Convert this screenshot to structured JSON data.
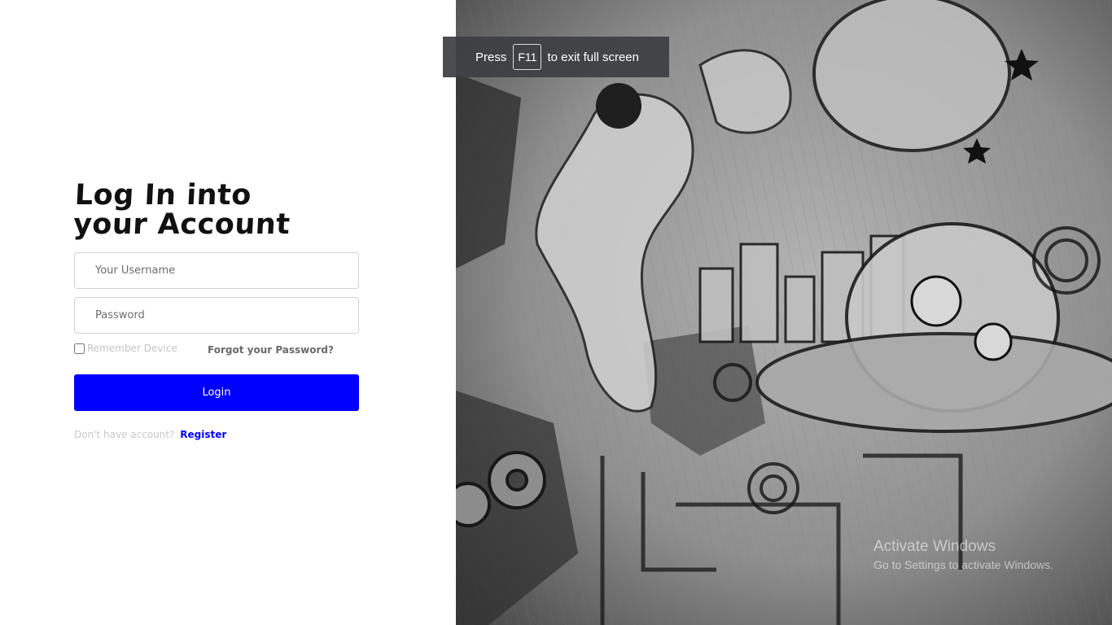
{
  "login": {
    "heading_line1": "Log In into",
    "heading_line2": "your Account",
    "username_placeholder": "Your Username",
    "password_placeholder": "Password",
    "remember_label": "Remember Device",
    "forgot_label": "Forgot your Password?",
    "login_button": "Login",
    "register_prompt": "Don't have account?",
    "register_link": "Register"
  },
  "fullscreen_toast": {
    "press": "Press",
    "key": "F11",
    "rest": "to exit full screen"
  },
  "watermark": {
    "title": "Activate Windows",
    "subtitle": "Go to Settings to activate Windows."
  },
  "colors": {
    "primary": "#0000ff",
    "panel_bg": "#ffffff",
    "toast_bg": "#3c3e42"
  }
}
